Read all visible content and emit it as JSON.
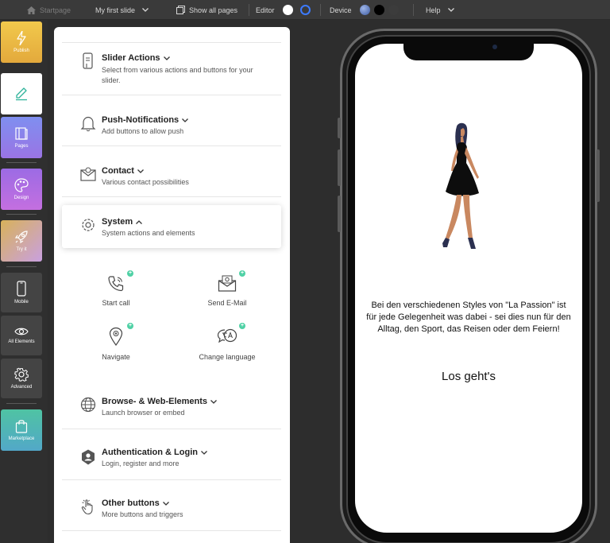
{
  "topbar": {
    "startpage": "Startpage",
    "slide_select": "My first slide",
    "show_all_pages": "Show all pages",
    "editor": "Editor",
    "device": "Device",
    "help": "Help"
  },
  "rail": {
    "publish": "Publish",
    "pages": "Pages",
    "design": "Design",
    "try_it": "Try it",
    "mobile": "Mobile",
    "all_elements": "All Elements",
    "advanced": "Advanced",
    "marketplace": "Marketplace"
  },
  "panel": {
    "rows": [
      {
        "title": "Slider Actions",
        "desc": "Select from various actions and buttons for your slider.",
        "icon": "phone-touch-icon"
      },
      {
        "title": "Push-Notifications",
        "desc": "Add buttons to allow push",
        "icon": "bell-icon"
      },
      {
        "title": "Contact",
        "desc": "Various contact possibilities",
        "icon": "envelope-icon"
      },
      {
        "title": "System",
        "desc": "System actions and elements",
        "icon": "gear-icon"
      },
      {
        "title": "Browse- & Web-Elements",
        "desc": "Launch browser or embed",
        "icon": "globe-icon"
      },
      {
        "title": "Authentication & Login",
        "desc": "Login, register and more",
        "icon": "user-shield-icon"
      },
      {
        "title": "Other buttons",
        "desc": "More buttons and triggers",
        "icon": "hand-tap-icon"
      }
    ],
    "system_items": [
      {
        "label": "Start call",
        "icon": "phone-call-icon"
      },
      {
        "label": "Send E-Mail",
        "icon": "email-at-icon"
      },
      {
        "label": "Navigate",
        "icon": "map-pin-icon"
      },
      {
        "label": "Change language",
        "icon": "language-icon"
      }
    ]
  },
  "preview": {
    "caption": "Bei den verschiedenen Styles von \"La Passion\" ist für jede Gelegenheit was dabei - sei dies nun für den Alltag, den Sport, das Reisen oder dem Feiern!",
    "cta": "Los geht's"
  },
  "colors": {
    "publish": "#e8b84b",
    "pages": "#8a7ee8",
    "design": "#b06ee0",
    "try_it": "#c9a24a",
    "marketplace": "#4fb8a8",
    "accent_plus": "#4fd1a5",
    "editor_active": "#3d7bff"
  }
}
